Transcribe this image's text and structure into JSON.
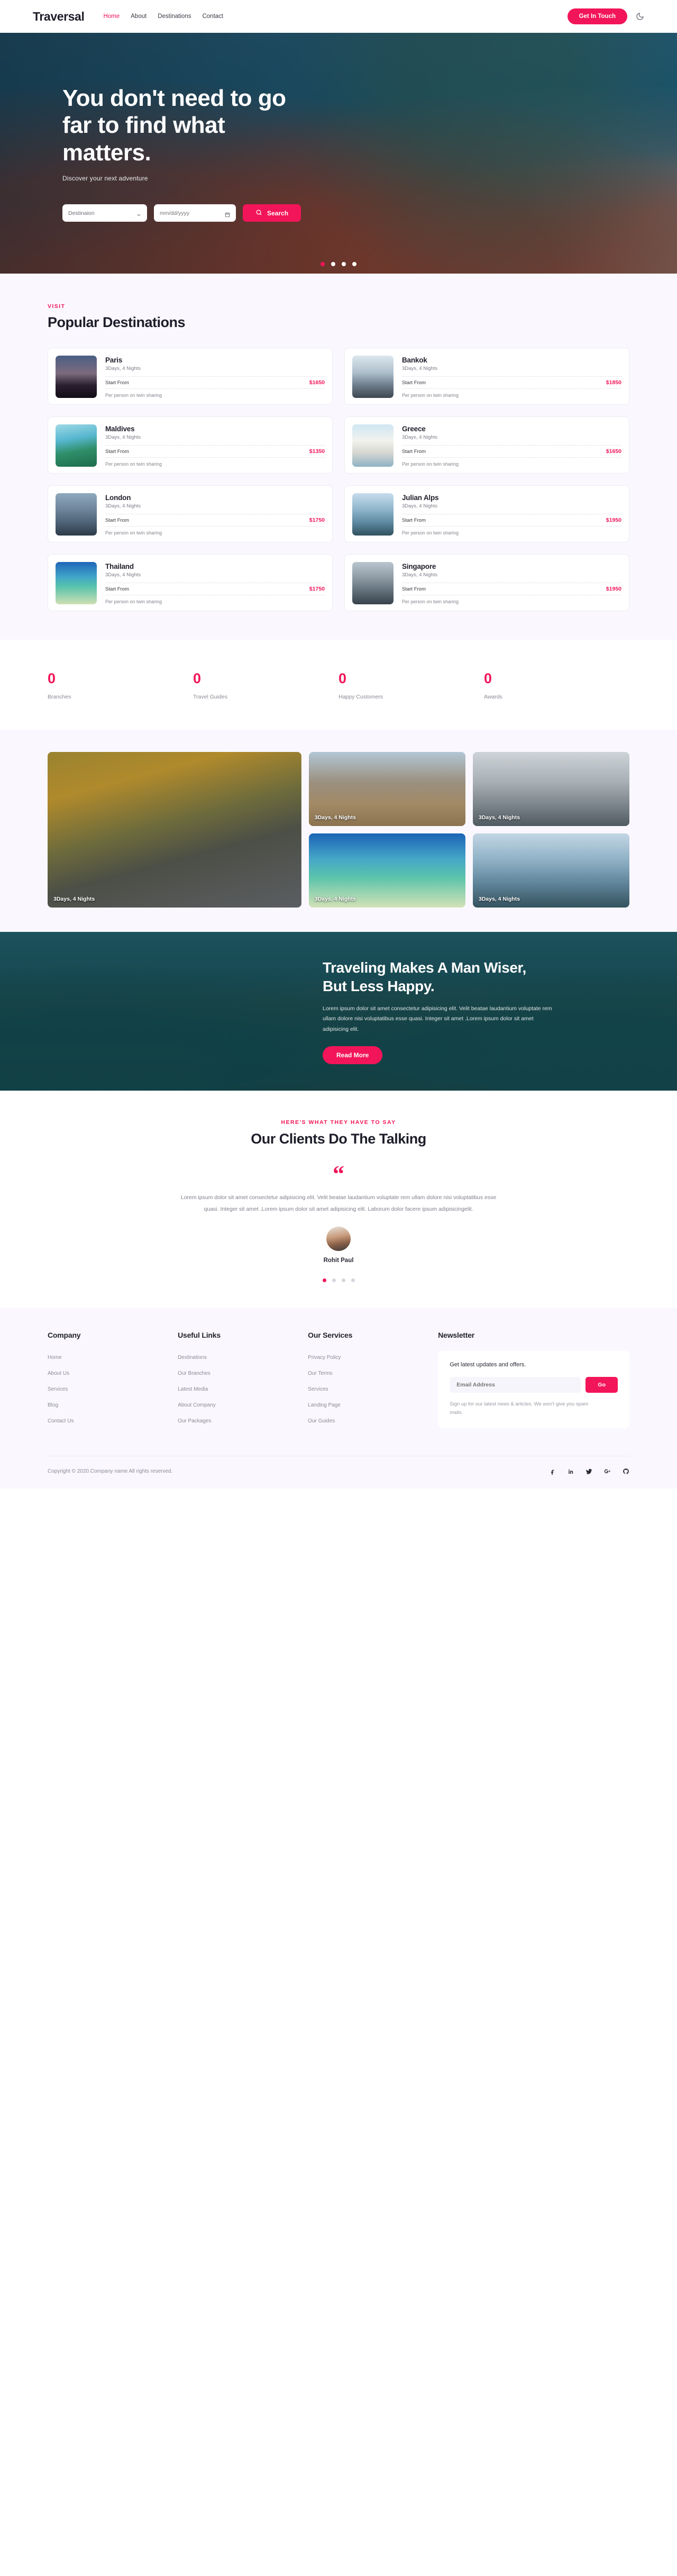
{
  "header": {
    "brand": "Traversal",
    "nav": [
      {
        "label": "Home",
        "active": true
      },
      {
        "label": "About",
        "active": false
      },
      {
        "label": "Destinations",
        "active": false
      },
      {
        "label": "Contact",
        "active": false
      }
    ],
    "cta_label": "Get In Touch",
    "theme_toggle_icon": "moon-icon"
  },
  "hero": {
    "title": "You don't need to go far to find what matters.",
    "subtitle": "Discover your next adventure",
    "destination_value": "Destinaion",
    "date_placeholder": "mm/dd/yyyy",
    "search_label": "Search",
    "search_icon": "search-icon",
    "dots": 4,
    "active_dot": 1
  },
  "destinations": {
    "eyebrow": "VISIT",
    "title": "Popular Destinations",
    "labels": {
      "start_from": "Start From",
      "note": "Per person on twin sharing"
    },
    "items": [
      {
        "name": "Paris",
        "duration": "3Days, 4 Nights",
        "price": "$1650",
        "thumb": "th-paris"
      },
      {
        "name": "Bankok",
        "duration": "3Days, 4 Nights",
        "price": "$1850",
        "thumb": "th-bankok"
      },
      {
        "name": "Maldives",
        "duration": "3Days, 4 Nights",
        "price": "$1350",
        "thumb": "th-maldives"
      },
      {
        "name": "Greece",
        "duration": "3Days, 4 Nights",
        "price": "$1650",
        "thumb": "th-greece"
      },
      {
        "name": "London",
        "duration": "3Days, 4 Nights",
        "price": "$1750",
        "thumb": "th-london"
      },
      {
        "name": "Julian Alps",
        "duration": "3Days, 4 Nights",
        "price": "$1950",
        "thumb": "th-julian"
      },
      {
        "name": "Thailand",
        "duration": "3Days, 4 Nights",
        "price": "$1750",
        "thumb": "th-thailand"
      },
      {
        "name": "Singapore",
        "duration": "3Days, 4 Nights",
        "price": "$1950",
        "thumb": "th-singapore"
      }
    ]
  },
  "stats": [
    {
      "value": "0",
      "label": "Branches"
    },
    {
      "value": "0",
      "label": "Travel Guides"
    },
    {
      "value": "0",
      "label": "Happy Customers"
    },
    {
      "value": "0",
      "label": "Awards"
    }
  ],
  "gallery": [
    {
      "caption": "3Days, 4 Nights",
      "tile": "g-road",
      "big": true
    },
    {
      "caption": "3Days, 4 Nights",
      "tile": "g-sphinx",
      "big": false
    },
    {
      "caption": "3Days, 4 Nights",
      "tile": "g-merlion",
      "big": false
    },
    {
      "caption": "3Days, 4 Nights",
      "tile": "g-boat",
      "big": false
    },
    {
      "caption": "3Days, 4 Nights",
      "tile": "g-hall",
      "big": false
    }
  ],
  "cta": {
    "title": "Traveling Makes A Man Wiser, But Less Happy.",
    "body": "Lorem ipsum dolor sit amet consectetur adipisicing elit. Velit beatae laudantium voluptate rem ullam dolore nisi voluptatibus esse quasi. Integer sit amet .Lorem ipsum dolor sit amet adipisicing elit.",
    "button_label": "Read More"
  },
  "testimonials": {
    "eyebrow": "HERE'S WHAT THEY HAVE TO SAY",
    "title": "Our Clients Do The Talking",
    "quote_icon": "quote-icon",
    "text": "Lorem ipsum dolor sit amet consectetur adipisicing elit. Velit beatae laudantium voluptate rem ullam dolore nisi voluptatibus esse quasi. Integer sit amet .Lorem ipsum dolor sit amet adipisicing elit. Laborum dolor facere ipsum adipisicingelit.",
    "author": "Rohit Paul",
    "dots": 4,
    "active_dot": 1
  },
  "footer": {
    "columns": [
      {
        "heading": "Company",
        "links": [
          "Home",
          "About Us",
          "Services",
          "Blog",
          "Contact Us"
        ]
      },
      {
        "heading": "Useful Links",
        "links": [
          "Destinations",
          "Our Branches",
          "Latest Media",
          "About Company",
          "Our Packages"
        ]
      },
      {
        "heading": "Our Services",
        "links": [
          "Privacy Policy",
          "Our Terms",
          "Services",
          "Landing Page",
          "Our Guides"
        ]
      }
    ],
    "newsletter": {
      "heading": "Newsletter",
      "lead": "Get latest updates and offers.",
      "email_placeholder": "Email Address",
      "go_label": "Go",
      "note": "Sign up for our latest news & articles. We won't give you spam mails."
    },
    "copyright": "Copyright © 2020.Company name All rights reserved.",
    "socials": [
      "facebook-icon",
      "linkedin-icon",
      "twitter-icon",
      "googleplus-icon",
      "github-icon"
    ]
  },
  "colors": {
    "accent": "#f31559",
    "page_bg": "#faf8fe",
    "text": "#1e1e2a",
    "muted": "#8b8b95"
  }
}
